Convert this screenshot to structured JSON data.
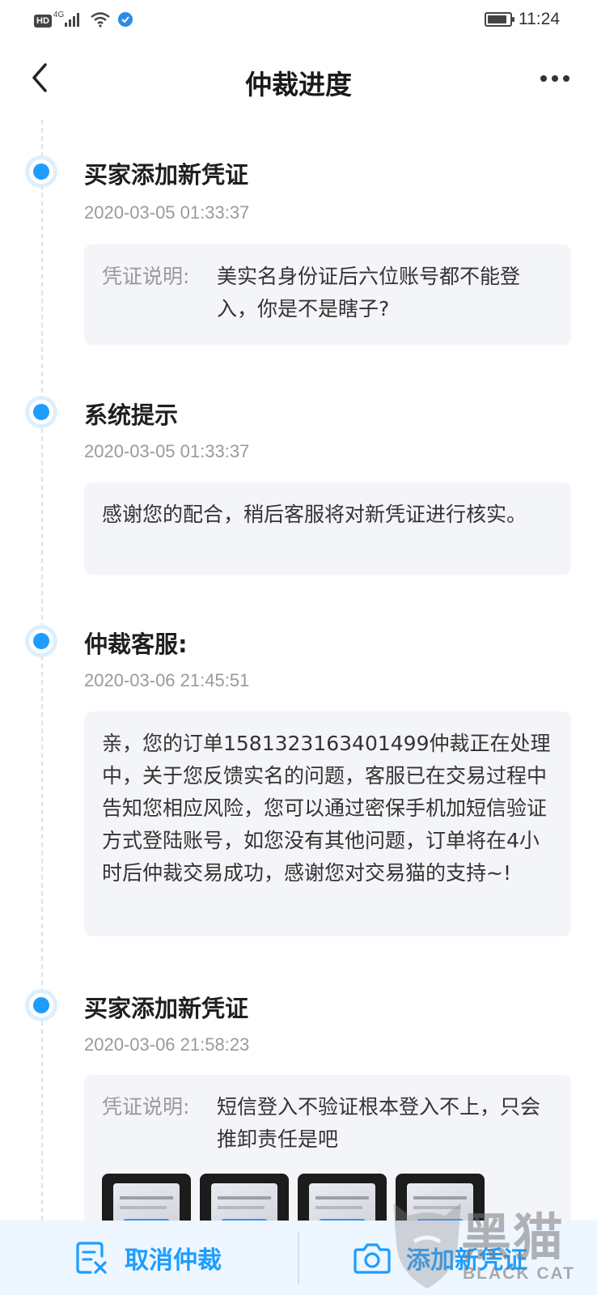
{
  "status_bar": {
    "network_badge": "HD",
    "network_type": "4G",
    "time": "11:24",
    "battery_level": 0.75,
    "icons": [
      "signal-icon",
      "wifi-icon",
      "vpn-icon",
      "battery-icon"
    ]
  },
  "header": {
    "title": "仲裁进度",
    "back_icon": "back-arrow-icon",
    "more_icon": "more-dots-icon"
  },
  "events": [
    {
      "title": "买家添加新凭证",
      "time": "2020-03-05 01:33:37",
      "label": "凭证说明:",
      "text": "美实名身份证后六位账号都不能登入，你是不是瞎子?"
    },
    {
      "title": "系统提示",
      "time": "2020-03-05 01:33:37",
      "text": "感谢您的配合，稍后客服将对新凭证进行核实。"
    },
    {
      "title": "仲裁客服:",
      "time": "2020-03-06 21:45:51",
      "text": "亲，您的订单1581323163401499仲裁正在处理中，关于您反馈实名的问题，客服已在交易过程中告知您相应风险，您可以通过密保手机加短信验证方式登陆账号，如您没有其他问题，订单将在4小时后仲裁交易成功，感谢您对交易猫的支持~!"
    },
    {
      "title": "买家添加新凭证",
      "time": "2020-03-06 21:58:23",
      "label": "凭证说明:",
      "text": "短信登入不验证根本登入不上，只会推卸责任是吧",
      "thumbnail_count": 4
    }
  ],
  "bottom_bar": {
    "cancel_label": "取消仲裁",
    "cancel_icon": "cancel-document-icon",
    "add_label": "添加新凭证",
    "add_icon": "camera-icon"
  },
  "watermark": {
    "brand": "黑猫",
    "sub": "BLACK CAT"
  },
  "colors": {
    "accent": "#1e9dff",
    "card_bg": "#f4f5f8",
    "bottom_bar_bg": "#eef6ff",
    "muted_text": "#9a9a9a"
  }
}
